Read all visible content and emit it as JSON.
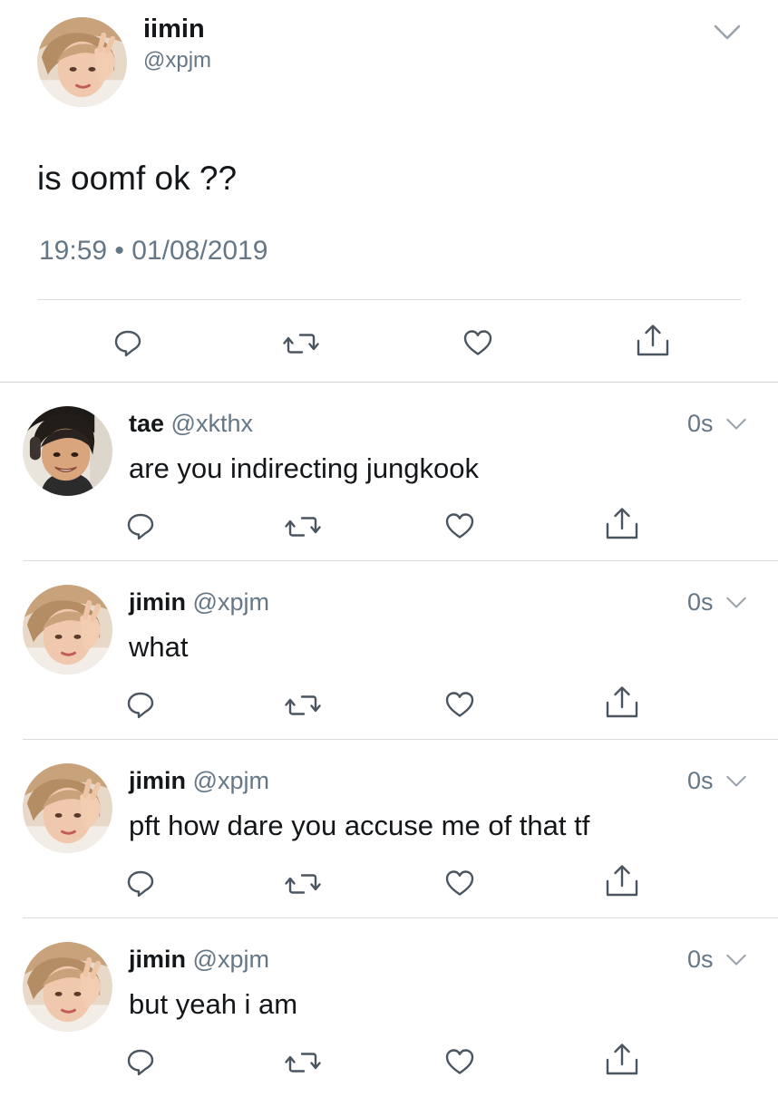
{
  "main_tweet": {
    "display_name": "iimin",
    "handle": "@xpjm",
    "text": "is oomf ok ??",
    "time": "19:59",
    "separator": "•",
    "date": "01/08/2019",
    "actions": [
      "reply-icon",
      "retweet-icon",
      "like-icon",
      "share-icon"
    ]
  },
  "replies": [
    {
      "display_name": "tae",
      "handle": "@xkthx",
      "time": "0s",
      "text": "are you indirecting jungkook"
    },
    {
      "display_name": "jimin",
      "handle": "@xpjm",
      "time": "0s",
      "text": "what"
    },
    {
      "display_name": "jimin",
      "handle": "@xpjm",
      "time": "0s",
      "text": "pft how dare you accuse me of that tf"
    },
    {
      "display_name": "jimin",
      "handle": "@xpjm",
      "time": "0s",
      "text": "but yeah i am"
    }
  ],
  "colors": {
    "text": "#14171a",
    "muted": "#657786",
    "icon": "#4a5560",
    "divider": "#d8dde1"
  }
}
